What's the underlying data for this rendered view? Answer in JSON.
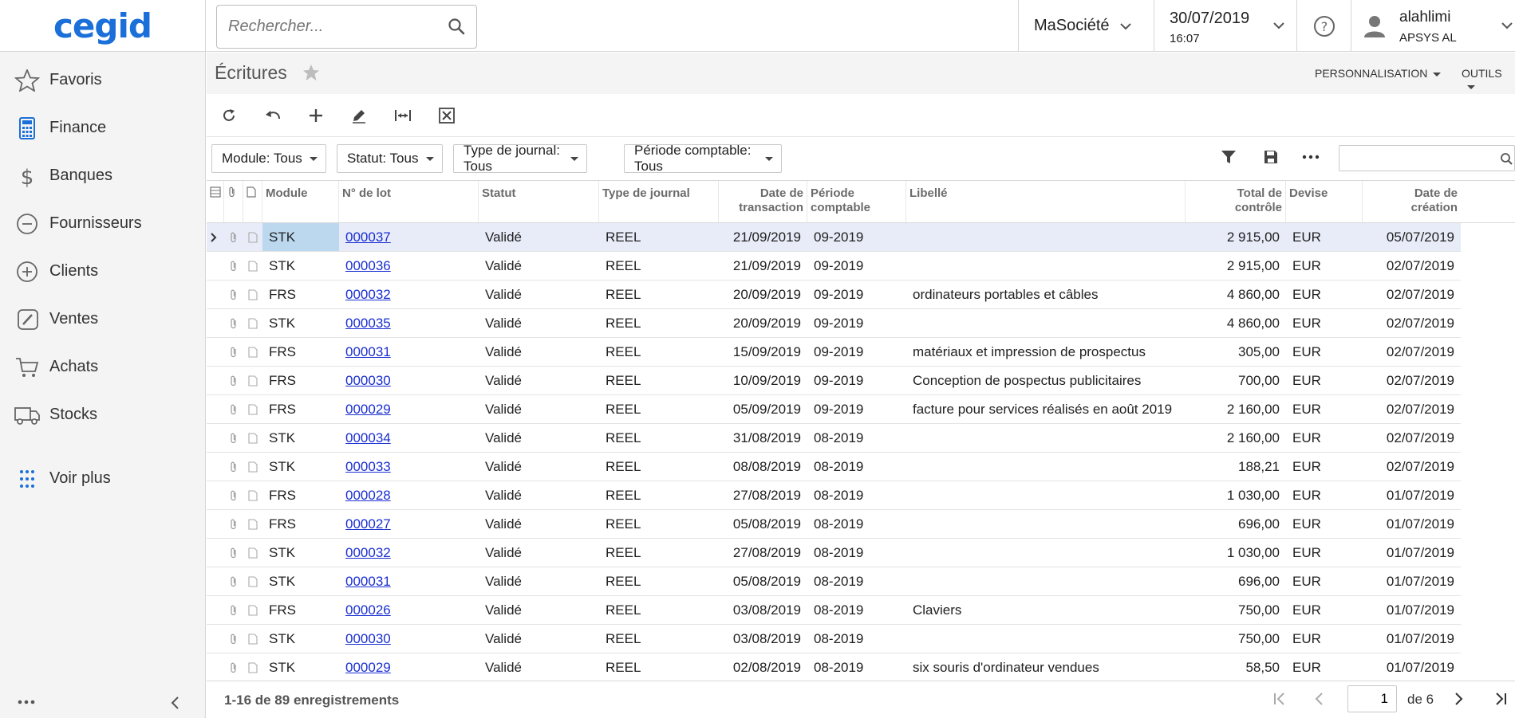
{
  "brand": {
    "logo_text": "cegid",
    "accent": "#1b6fd9"
  },
  "search": {
    "placeholder": "Rechercher..."
  },
  "header": {
    "company": "MaSociété",
    "date": "30/07/2019",
    "time": "16:07",
    "user_name": "alahlimi",
    "user_org": "APSYS AL"
  },
  "sidebar": {
    "items": [
      {
        "label": "Favoris",
        "icon": "star-icon"
      },
      {
        "label": "Finance",
        "icon": "calculator-icon"
      },
      {
        "label": "Banques",
        "icon": "dollar-icon"
      },
      {
        "label": "Fournisseurs",
        "icon": "minus-circle-icon"
      },
      {
        "label": "Clients",
        "icon": "plus-circle-icon"
      },
      {
        "label": "Ventes",
        "icon": "edit-icon"
      },
      {
        "label": "Achats",
        "icon": "cart-icon"
      },
      {
        "label": "Stocks",
        "icon": "truck-icon"
      },
      {
        "label": "Voir plus",
        "icon": "grid-dots-icon"
      }
    ]
  },
  "page": {
    "title": "Écritures",
    "personnalisation": "PERSONNALISATION",
    "outils": "OUTILS"
  },
  "filters": {
    "module": "Module: Tous",
    "statut": "Statut: Tous",
    "type_journal": "Type de journal: Tous",
    "periode": "Période comptable: Tous"
  },
  "columns": {
    "module": "Module",
    "lot": "N° de lot",
    "statut": "Statut",
    "type": "Type de journal",
    "date_tx_1": "Date de",
    "date_tx_2": "transaction",
    "periode_1": "Période",
    "periode_2": "comptable",
    "libelle": "Libellé",
    "total_1": "Total de",
    "total_2": "contrôle",
    "devise": "Devise",
    "date_cr_1": "Date de",
    "date_cr_2": "création"
  },
  "rows": [
    {
      "module": "STK",
      "lot": "000037",
      "statut": "Validé",
      "type": "REEL",
      "date_tx": "21/09/2019",
      "periode": "09-2019",
      "libelle": "",
      "total": "2 915,00",
      "devise": "EUR",
      "date_cr": "05/07/2019"
    },
    {
      "module": "STK",
      "lot": "000036",
      "statut": "Validé",
      "type": "REEL",
      "date_tx": "21/09/2019",
      "periode": "09-2019",
      "libelle": "",
      "total": "2 915,00",
      "devise": "EUR",
      "date_cr": "02/07/2019"
    },
    {
      "module": "FRS",
      "lot": "000032",
      "statut": "Validé",
      "type": "REEL",
      "date_tx": "20/09/2019",
      "periode": "09-2019",
      "libelle": "ordinateurs portables et câbles",
      "total": "4 860,00",
      "devise": "EUR",
      "date_cr": "02/07/2019"
    },
    {
      "module": "STK",
      "lot": "000035",
      "statut": "Validé",
      "type": "REEL",
      "date_tx": "20/09/2019",
      "periode": "09-2019",
      "libelle": "",
      "total": "4 860,00",
      "devise": "EUR",
      "date_cr": "02/07/2019"
    },
    {
      "module": "FRS",
      "lot": "000031",
      "statut": "Validé",
      "type": "REEL",
      "date_tx": "15/09/2019",
      "periode": "09-2019",
      "libelle": "matériaux et impression de prospectus",
      "total": "305,00",
      "devise": "EUR",
      "date_cr": "02/07/2019"
    },
    {
      "module": "FRS",
      "lot": "000030",
      "statut": "Validé",
      "type": "REEL",
      "date_tx": "10/09/2019",
      "periode": "09-2019",
      "libelle": "Conception de pospectus publicitaires",
      "total": "700,00",
      "devise": "EUR",
      "date_cr": "02/07/2019"
    },
    {
      "module": "FRS",
      "lot": "000029",
      "statut": "Validé",
      "type": "REEL",
      "date_tx": "05/09/2019",
      "periode": "09-2019",
      "libelle": "facture pour services réalisés en août 2019",
      "total": "2 160,00",
      "devise": "EUR",
      "date_cr": "02/07/2019"
    },
    {
      "module": "STK",
      "lot": "000034",
      "statut": "Validé",
      "type": "REEL",
      "date_tx": "31/08/2019",
      "periode": "08-2019",
      "libelle": "",
      "total": "2 160,00",
      "devise": "EUR",
      "date_cr": "02/07/2019"
    },
    {
      "module": "STK",
      "lot": "000033",
      "statut": "Validé",
      "type": "REEL",
      "date_tx": "08/08/2019",
      "periode": "08-2019",
      "libelle": "",
      "total": "188,21",
      "devise": "EUR",
      "date_cr": "02/07/2019"
    },
    {
      "module": "FRS",
      "lot": "000028",
      "statut": "Validé",
      "type": "REEL",
      "date_tx": "27/08/2019",
      "periode": "08-2019",
      "libelle": "",
      "total": "1 030,00",
      "devise": "EUR",
      "date_cr": "01/07/2019"
    },
    {
      "module": "FRS",
      "lot": "000027",
      "statut": "Validé",
      "type": "REEL",
      "date_tx": "05/08/2019",
      "periode": "08-2019",
      "libelle": "",
      "total": "696,00",
      "devise": "EUR",
      "date_cr": "01/07/2019"
    },
    {
      "module": "STK",
      "lot": "000032",
      "statut": "Validé",
      "type": "REEL",
      "date_tx": "27/08/2019",
      "periode": "08-2019",
      "libelle": "",
      "total": "1 030,00",
      "devise": "EUR",
      "date_cr": "01/07/2019"
    },
    {
      "module": "STK",
      "lot": "000031",
      "statut": "Validé",
      "type": "REEL",
      "date_tx": "05/08/2019",
      "periode": "08-2019",
      "libelle": "",
      "total": "696,00",
      "devise": "EUR",
      "date_cr": "01/07/2019"
    },
    {
      "module": "FRS",
      "lot": "000026",
      "statut": "Validé",
      "type": "REEL",
      "date_tx": "03/08/2019",
      "periode": "08-2019",
      "libelle": "Claviers",
      "total": "750,00",
      "devise": "EUR",
      "date_cr": "01/07/2019"
    },
    {
      "module": "STK",
      "lot": "000030",
      "statut": "Validé",
      "type": "REEL",
      "date_tx": "03/08/2019",
      "periode": "08-2019",
      "libelle": "",
      "total": "750,00",
      "devise": "EUR",
      "date_cr": "01/07/2019"
    },
    {
      "module": "STK",
      "lot": "000029",
      "statut": "Validé",
      "type": "REEL",
      "date_tx": "02/08/2019",
      "periode": "08-2019",
      "libelle": "six souris d'ordinateur vendues",
      "total": "58,50",
      "devise": "EUR",
      "date_cr": "01/07/2019"
    }
  ],
  "pager": {
    "count_text": "1-16 de 89 enregistrements",
    "current_page": "1",
    "of_text": "de 6"
  }
}
